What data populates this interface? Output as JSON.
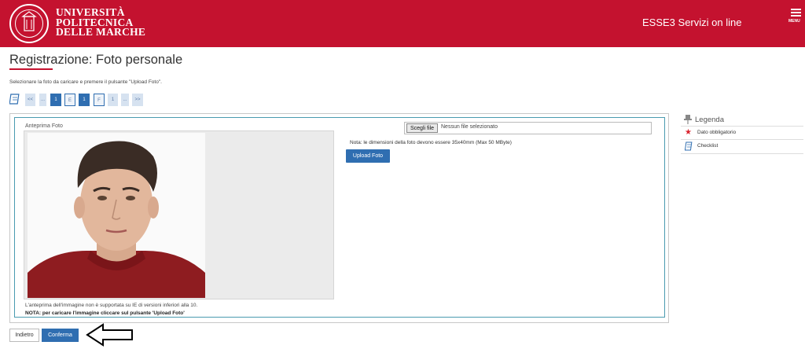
{
  "header": {
    "university_lines": [
      "UNIVERSITÀ",
      "POLITECNICA",
      "DELLE MARCHE"
    ],
    "service_title": "ESSE3 Servizi on line",
    "menu_label": "MENU",
    "brand_color": "#c4122f"
  },
  "page": {
    "title": "Registrazione: Foto personale",
    "instructions": "Selezionare la foto da caricare e premere il pulsante \"Upload Foto\"."
  },
  "pager": {
    "items": [
      "<<",
      "...",
      "1",
      "E",
      "1",
      "F",
      "1",
      "...",
      ">>"
    ],
    "accent_color": "#2f6eb1"
  },
  "upload": {
    "preview_label": "Anteprima Foto",
    "file_button": "Scegli file",
    "file_status": "Nessun file selezionato",
    "note": "Nota: le dimensioni della foto devono essere 35x40mm (Max 50 MByte)",
    "upload_button": "Upload Foto",
    "ie_note": "L'anteprima dell'immagine non è supportata su IE di versioni inferiori alla 10.",
    "nota": "NOTA: per caricare l'immagine cliccare sul pulsante 'Upload Foto'"
  },
  "legend": {
    "title": "Legenda",
    "items": [
      {
        "icon": "star-icon",
        "label": "Dato obbligatorio"
      },
      {
        "icon": "checklist-icon",
        "label": "Checklist"
      }
    ]
  },
  "actions": {
    "back": "Indietro",
    "confirm": "Conferma"
  }
}
